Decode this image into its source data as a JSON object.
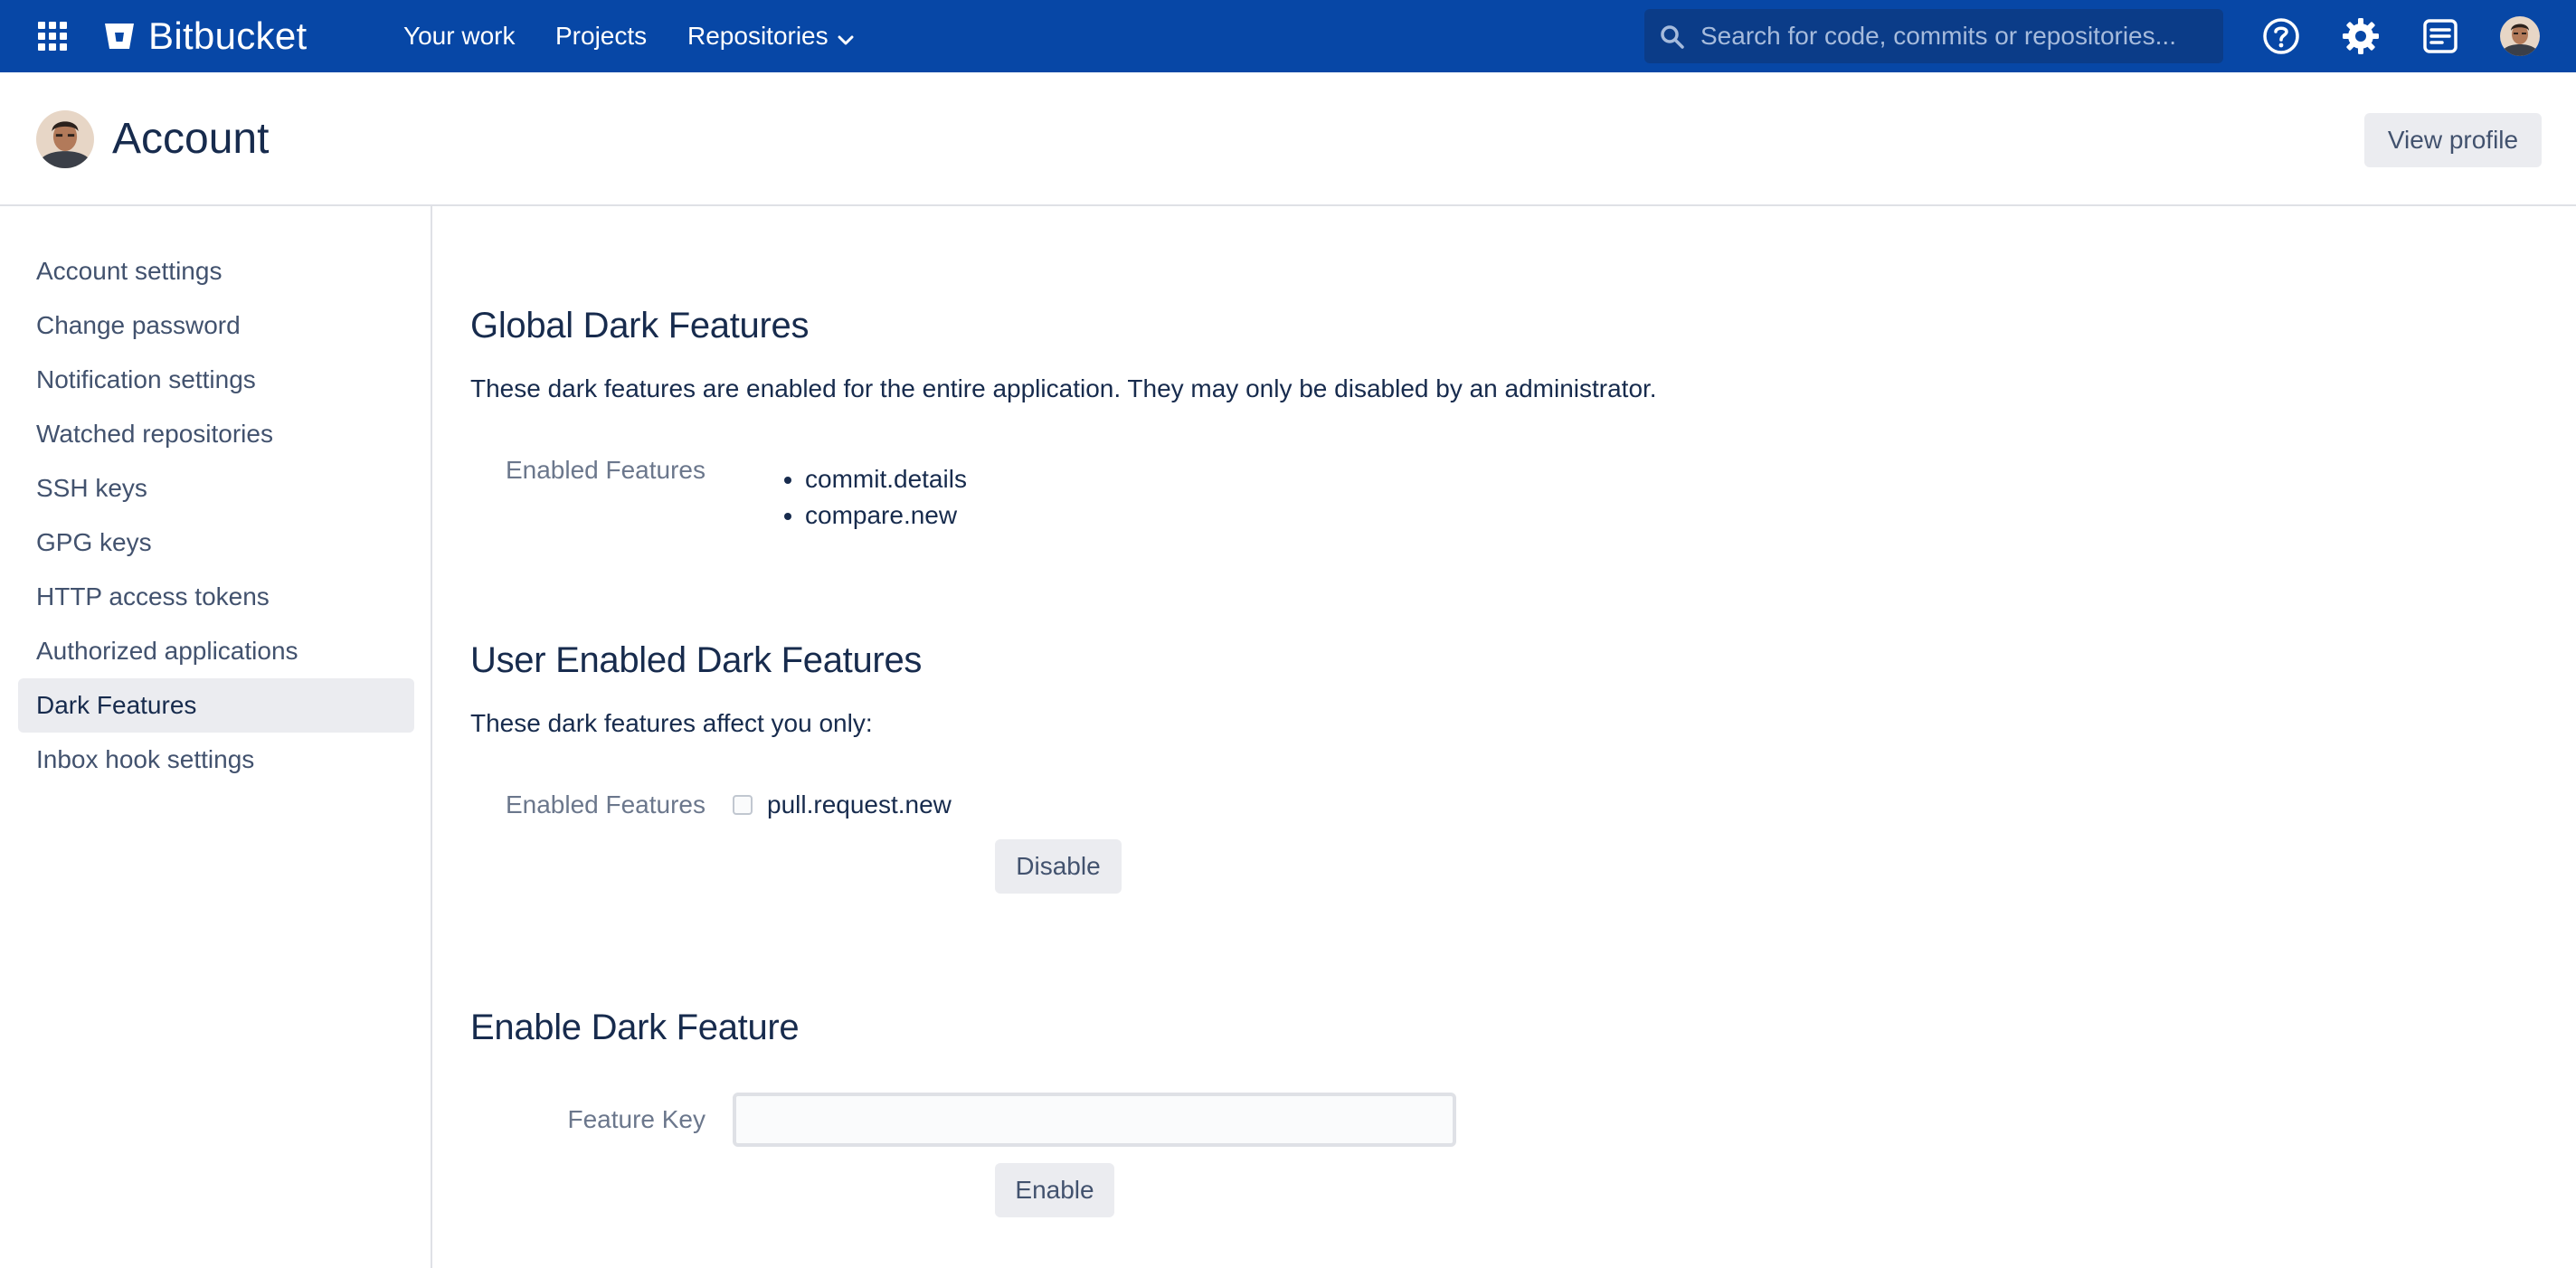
{
  "topnav": {
    "brand": "Bitbucket",
    "items": [
      {
        "label": "Your work"
      },
      {
        "label": "Projects"
      },
      {
        "label": "Repositories"
      }
    ],
    "search_placeholder": "Search for code, commits or repositories..."
  },
  "header": {
    "title": "Account",
    "view_profile": "View profile"
  },
  "sidebar": {
    "items": [
      {
        "label": "Account settings"
      },
      {
        "label": "Change password"
      },
      {
        "label": "Notification settings"
      },
      {
        "label": "Watched repositories"
      },
      {
        "label": "SSH keys"
      },
      {
        "label": "GPG keys"
      },
      {
        "label": "HTTP access tokens"
      },
      {
        "label": "Authorized applications"
      },
      {
        "label": "Dark Features",
        "active": true
      },
      {
        "label": "Inbox hook settings"
      }
    ]
  },
  "global": {
    "title": "Global Dark Features",
    "description": "These dark features are enabled for the entire application. They may only be disabled by an administrator.",
    "label": "Enabled Features",
    "features": [
      "commit.details",
      "compare.new"
    ]
  },
  "user": {
    "title": "User Enabled Dark Features",
    "description": "These dark features affect you only:",
    "label": "Enabled Features",
    "feature": "pull.request.new",
    "checked": false,
    "button": "Disable"
  },
  "enable": {
    "title": "Enable Dark Feature",
    "label": "Feature Key",
    "value": "",
    "button": "Enable"
  },
  "colors": {
    "nav_bg": "#0747a6",
    "active_bg": "#ebecf0",
    "text": "#172b4d",
    "muted": "#6b778c"
  }
}
